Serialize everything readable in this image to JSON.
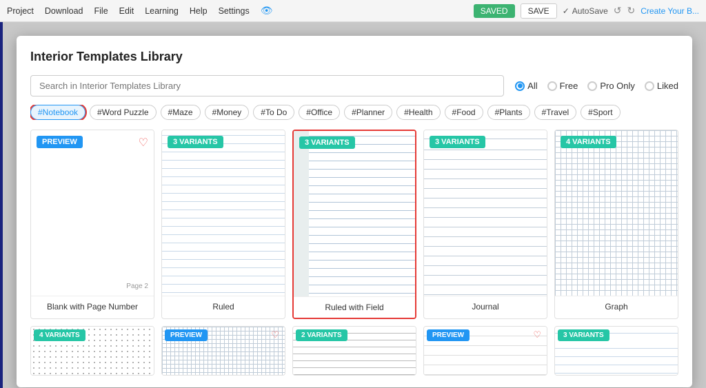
{
  "menubar": {
    "items": [
      "Project",
      "Download",
      "File",
      "Edit",
      "Learning",
      "Help",
      "Settings"
    ],
    "saved_label": "SAVED",
    "save_label": "SAVE",
    "autosave_label": "AutoSave",
    "create_label": "Create Your B..."
  },
  "modal": {
    "title": "Interior Templates Library",
    "search_placeholder": "Search in Interior Templates Library",
    "radio_options": [
      "All",
      "Free",
      "Pro Only",
      "Liked"
    ],
    "active_radio": "All",
    "tags": [
      "#Notebook",
      "#Word Puzzle",
      "#Maze",
      "#Money",
      "#To Do",
      "#Office",
      "#Planner",
      "#Health",
      "#Food",
      "#Plants",
      "#Travel",
      "#Sport"
    ],
    "active_tag": "#Notebook"
  },
  "templates": {
    "row1": [
      {
        "badge": "PREVIEW",
        "badge_type": "blue",
        "heart": true,
        "label": "Blank with Page Number",
        "pattern": "blank-page",
        "selected": false
      },
      {
        "badge": "3 VARIANTS",
        "badge_type": "green",
        "heart": false,
        "label": "Ruled",
        "pattern": "ruled",
        "selected": false
      },
      {
        "badge": "3 VARIANTS",
        "badge_type": "green",
        "heart": false,
        "label": "Ruled with Field",
        "pattern": "ruled-field",
        "selected": true
      },
      {
        "badge": "3 VARIANTS",
        "badge_type": "green",
        "heart": false,
        "label": "Journal",
        "pattern": "journal",
        "selected": false
      },
      {
        "badge": "4 VARIANTS",
        "badge_type": "green",
        "heart": false,
        "label": "Graph",
        "pattern": "graph",
        "selected": false
      }
    ],
    "row2": [
      {
        "badge": "4 VARIANTS",
        "badge_type": "green",
        "heart": false,
        "label": "",
        "pattern": "dot",
        "selected": false
      },
      {
        "badge": "PREVIEW",
        "badge_type": "blue",
        "heart": true,
        "label": "",
        "pattern": "graph-small",
        "selected": false
      },
      {
        "badge": "2 VARIANTS",
        "badge_type": "green",
        "heart": false,
        "label": "",
        "pattern": "h-lines",
        "selected": false
      },
      {
        "badge": "PREVIEW",
        "badge_type": "blue",
        "heart": true,
        "label": "",
        "pattern": "light-lines",
        "selected": false
      },
      {
        "badge": "3 VARIANTS",
        "badge_type": "green",
        "heart": false,
        "label": "",
        "pattern": "ruled2",
        "selected": false
      }
    ]
  }
}
